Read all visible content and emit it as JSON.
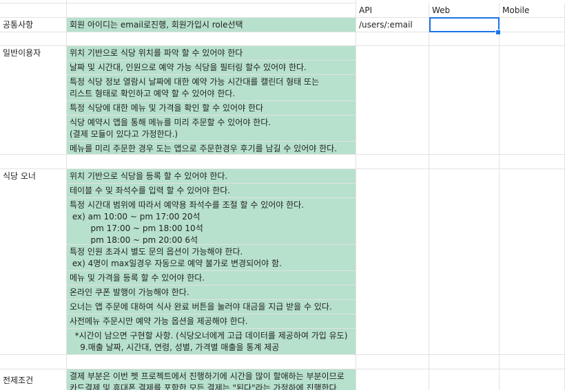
{
  "headers": {
    "api": "API",
    "web": "Web",
    "mobile": "Mobile"
  },
  "common": {
    "label": "공통사항",
    "desc": "회원 아이디는 email로진행, 회원가입시 role선택",
    "api": "/users/:email"
  },
  "general_user": {
    "label": "일반이용자",
    "items": [
      "위치 기반으로 식당 위치를 파악 할 수 있어야 한다",
      "날짜 및 시간대, 인원으로 예약 가능 식당을 필터링 할수 있어야 한다.",
      "특정 식당 정보 열람시 날짜에 대한 예약 가능 시간대를 캘린더 형태 또는\n리스트 형태로 확인하고 예약 할 수 있어야 한다.",
      "특정 식당에 대한 메뉴 및 가격을 확인 할 수 있어야 한다",
      "식당 예약시 앱을 통해 메뉴를 미리 주문할 수 있어야 한다.\n(결제 모듈이 있다고 가정한다.)",
      "메뉴를 미리 주문한 경우 도는 앱으로 주문한경우 후기를 남길 수 있어야 한다."
    ]
  },
  "owner": {
    "label": "식당 오너",
    "items": [
      "위치 기반으로 식당을 등록 할 수 있어야 한다.",
      "테이블 수 및 좌석수를 입력 할 수 있어야 한다.",
      "특정 시간대 범위에 따라서 예약용 좌석수를 조절 할 수 있어야 한다.\n ex) am 10:00 ~ pm 17:00 20석\n        pm 17:00 ~ pm 18:00 10석\n        pm 18:00 ~ pm 20:00 6석",
      "특정 인원 초과시 별도 문의 옵션이 가능해야 한다.\n ex) 4명이 max일경우 자동으로 예약 불가로 변경되어야 함.",
      "메뉴 및 가격을 등록 할 수 있어야 한다.",
      "온라인 쿠폰 발행이 가능해야 한다.",
      "오너는 앱 주문에 대하여 식사 완료 버튼을 눌러야 대금을 지급 받을 수 있다.",
      "사전메뉴 주문시만 예약 가능 옵션을 제공해야 한다.",
      "  *시간이 남으면 구현할 사항. (식당오너에게 고급 데이터를 제공하여 가입 유도)\n    9.매출 날짜, 시간대, 연령, 성별, 가격별 매출을 통계 제공"
    ]
  },
  "premise": {
    "label": "전제조건",
    "desc": "결제 부분은 이번 펫 프로젝트에서 진행하기에 시간을 많이 할애하는 부분이므로\n카드결제 및 휴대폰 결제를 포함한 모든 결제는 \"된다\"라는 가정하에 진행한다"
  }
}
